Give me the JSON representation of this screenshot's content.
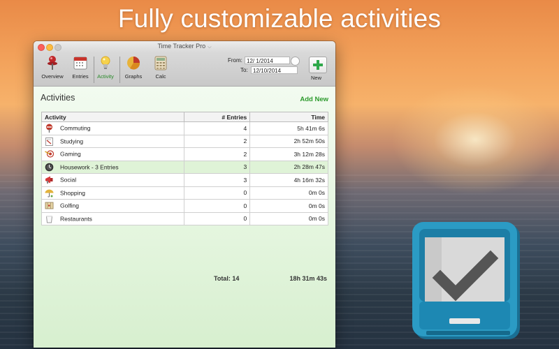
{
  "headline": "Fully customizable activities",
  "window": {
    "title": "Time Tracker Pro"
  },
  "toolbar": {
    "items": [
      {
        "label": "Overview",
        "icon": "pushpin-icon",
        "active": false
      },
      {
        "label": "Entries",
        "icon": "calendar-icon",
        "active": false
      },
      {
        "label": "Activity",
        "icon": "lightbulb-icon",
        "active": true
      },
      {
        "label": "Graphs",
        "icon": "pie-chart-icon",
        "active": false
      },
      {
        "label": "Calc",
        "icon": "calculator-icon",
        "active": false
      }
    ],
    "from_label": "From:",
    "from_value": "12/  1/2014",
    "to_label": "To:",
    "to_value": "12/10/2014",
    "new_label": "New"
  },
  "activities": {
    "title": "Activities",
    "add_new": "Add New",
    "columns": [
      "Activity",
      "# Entries",
      "Time"
    ],
    "rows": [
      {
        "name": "Commuting",
        "entries": "4",
        "time": "5h 41m 6s",
        "icon": "stop-sign-icon"
      },
      {
        "name": "Studying",
        "entries": "2",
        "time": "2h 52m 50s",
        "icon": "notepad-icon"
      },
      {
        "name": "Gaming",
        "entries": "2",
        "time": "3h 12m 28s",
        "icon": "target-icon"
      },
      {
        "name": "Housework - 3 Entries",
        "entries": "3",
        "time": "2h 28m 47s",
        "icon": "clock-icon"
      },
      {
        "name": "Social",
        "entries": "3",
        "time": "4h 16m 32s",
        "icon": "megaphone-icon"
      },
      {
        "name": "Shopping",
        "entries": "0",
        "time": "0m 0s",
        "icon": "umbrella-icon"
      },
      {
        "name": "Golfing",
        "entries": "0",
        "time": "0m 0s",
        "icon": "map-icon"
      },
      {
        "name": "Restaurants",
        "entries": "0",
        "time": "0m 0s",
        "icon": "cup-icon"
      }
    ],
    "selected_row": 3,
    "total_entries": "Total: 14",
    "total_time": "18h 31m 43s"
  },
  "colors": {
    "accent": "#2d9a2d",
    "app_icon_blue": "#2b9bc4",
    "app_icon_dark": "#1a6f93"
  }
}
